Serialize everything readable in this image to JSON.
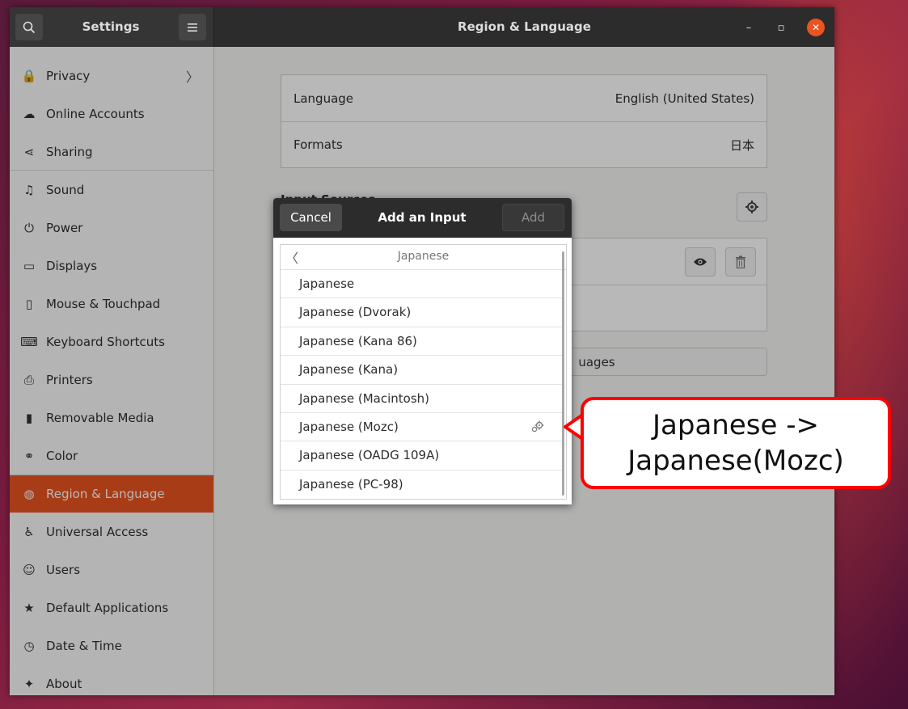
{
  "window": {
    "app_title": "Settings",
    "page_title": "Region & Language"
  },
  "sidebar": {
    "items": [
      {
        "label": "Privacy",
        "icon": "lock-icon",
        "glyph": "🔒"
      },
      {
        "label": "Online Accounts",
        "icon": "cloud-icon",
        "glyph": "☁"
      },
      {
        "label": "Sharing",
        "icon": "share-icon",
        "glyph": "⋖"
      },
      {
        "label": "Sound",
        "icon": "music-note-icon",
        "glyph": "♫"
      },
      {
        "label": "Power",
        "icon": "power-icon",
        "glyph": "⏻"
      },
      {
        "label": "Displays",
        "icon": "display-icon",
        "glyph": "▭"
      },
      {
        "label": "Mouse & Touchpad",
        "icon": "mouse-icon",
        "glyph": "▯"
      },
      {
        "label": "Keyboard Shortcuts",
        "icon": "keyboard-icon",
        "glyph": "⌨"
      },
      {
        "label": "Printers",
        "icon": "printer-icon",
        "glyph": "⎙"
      },
      {
        "label": "Removable Media",
        "icon": "removable-media-icon",
        "glyph": "▮"
      },
      {
        "label": "Color",
        "icon": "color-icon",
        "glyph": "⚭"
      },
      {
        "label": "Region & Language",
        "icon": "globe-icon",
        "glyph": "◍"
      },
      {
        "label": "Universal Access",
        "icon": "accessibility-icon",
        "glyph": "♿"
      },
      {
        "label": "Users",
        "icon": "users-icon",
        "glyph": "☺"
      },
      {
        "label": "Default Applications",
        "icon": "star-icon",
        "glyph": "★"
      },
      {
        "label": "Date & Time",
        "icon": "clock-icon",
        "glyph": "◷"
      },
      {
        "label": "About",
        "icon": "about-icon",
        "glyph": "✦"
      }
    ],
    "active_index": 11
  },
  "region": {
    "language_label": "Language",
    "language_value": "English (United States)",
    "formats_label": "Formats",
    "formats_value": "日本",
    "input_sources_heading": "Input Sources",
    "manage_languages_partial": "uages"
  },
  "dialog": {
    "cancel_label": "Cancel",
    "title": "Add an Input Source",
    "add_label": "Add",
    "list_header": "Japanese",
    "items": [
      "Japanese",
      "Japanese (Dvorak)",
      "Japanese (Kana 86)",
      "Japanese (Kana)",
      "Japanese (Macintosh)",
      "Japanese (Mozc)",
      "Japanese (OADG 109A)",
      "Japanese (PC-98)"
    ],
    "settings_item_index": 5
  },
  "callout": {
    "line1": "Japanese ->",
    "line2": "Japanese(Mozc)",
    "border_color": "#ff0000"
  },
  "colors": {
    "accent": "#e95420",
    "headerbar": "#2c2c2c"
  }
}
